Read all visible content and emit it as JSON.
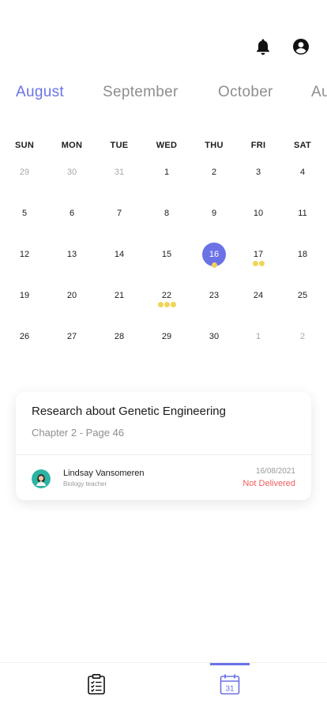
{
  "header": {
    "icons": [
      "bell-icon",
      "account-circle-icon"
    ]
  },
  "months": [
    {
      "label": "August",
      "active": true
    },
    {
      "label": "September",
      "active": false
    },
    {
      "label": "October",
      "active": false
    },
    {
      "label": "Au",
      "active": false
    }
  ],
  "calendar": {
    "weekdays": [
      "SUN",
      "MON",
      "TUE",
      "WED",
      "THU",
      "FRI",
      "SAT"
    ],
    "weeks": [
      [
        {
          "d": "29",
          "muted": true
        },
        {
          "d": "30",
          "muted": true
        },
        {
          "d": "31",
          "muted": true
        },
        {
          "d": "1"
        },
        {
          "d": "2"
        },
        {
          "d": "3"
        },
        {
          "d": "4"
        }
      ],
      [
        {
          "d": "5"
        },
        {
          "d": "6"
        },
        {
          "d": "7"
        },
        {
          "d": "8"
        },
        {
          "d": "9"
        },
        {
          "d": "10"
        },
        {
          "d": "11"
        }
      ],
      [
        {
          "d": "12"
        },
        {
          "d": "13"
        },
        {
          "d": "14"
        },
        {
          "d": "15"
        },
        {
          "d": "16",
          "selected": true,
          "dots": 1
        },
        {
          "d": "17",
          "dots": 2
        },
        {
          "d": "18"
        }
      ],
      [
        {
          "d": "19"
        },
        {
          "d": "20"
        },
        {
          "d": "21"
        },
        {
          "d": "22",
          "dots": 3
        },
        {
          "d": "23"
        },
        {
          "d": "24"
        },
        {
          "d": "25"
        }
      ],
      [
        {
          "d": "26"
        },
        {
          "d": "27"
        },
        {
          "d": "28"
        },
        {
          "d": "29"
        },
        {
          "d": "30"
        },
        {
          "d": "1",
          "muted": true
        },
        {
          "d": "2",
          "muted": true
        }
      ]
    ]
  },
  "assignment": {
    "title": "Research about Genetic Engineering",
    "subtitle": "Chapter 2 - Page 46",
    "teacher_name": "Lindsay Vansomeren",
    "teacher_role": "Biology teacher",
    "date": "16/08/2021",
    "status": "Not Delivered"
  },
  "bottom_nav": {
    "items": [
      {
        "icon": "clipboard-checklist-icon",
        "active": false
      },
      {
        "icon": "calendar-icon",
        "calendar_day": "31",
        "active": true
      }
    ]
  },
  "colors": {
    "accent": "#6a72e6",
    "event_dot": "#f0d458",
    "status_not_delivered": "#ef5d5d",
    "muted_text": "#8e8e8e"
  }
}
